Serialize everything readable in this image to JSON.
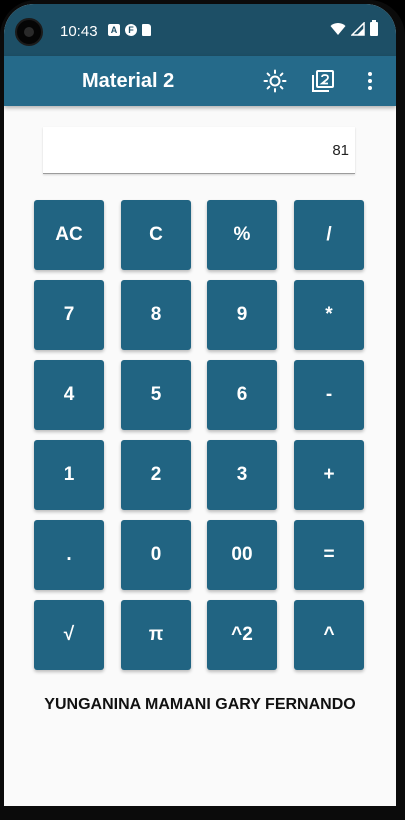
{
  "status_bar": {
    "time": "10:43",
    "icons": [
      "A",
      "F",
      "sim"
    ]
  },
  "app_bar": {
    "title": "Material 2",
    "actions": [
      "brightness-icon",
      "filter-2-icon",
      "more-vert-icon"
    ]
  },
  "display": {
    "value": "81"
  },
  "keys": [
    [
      "AC",
      "C",
      "%",
      "/"
    ],
    [
      "7",
      "8",
      "9",
      "*"
    ],
    [
      "4",
      "5",
      "6",
      "-"
    ],
    [
      "1",
      "2",
      "3",
      "+"
    ],
    [
      ".",
      "0",
      "00",
      "="
    ],
    [
      "√",
      "π",
      "^2",
      "^"
    ]
  ],
  "footer": {
    "author": "YUNGANINA MAMANI GARY FERNANDO"
  },
  "colors": {
    "status_bar": "#1d4f66",
    "app_bar": "#256a8a",
    "key": "#216482",
    "background": "#fafafa"
  }
}
